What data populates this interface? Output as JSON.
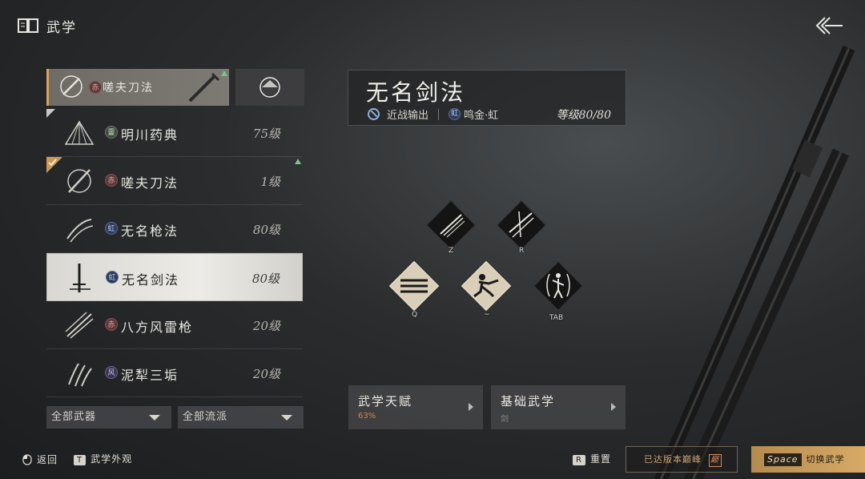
{
  "header": {
    "title": "武学",
    "book_icon": "book-icon",
    "back_icon": "back-arrow-icon"
  },
  "martial_list": {
    "equipped": {
      "badge": "赤",
      "name": "嗟夫刀法"
    },
    "items": [
      {
        "badge": "靈",
        "name": "明川药典",
        "level": "75级",
        "badge_color": "green"
      },
      {
        "badge": "赤",
        "name": "嗟夫刀法",
        "level": "1级",
        "badge_color": "red"
      },
      {
        "badge": "虹",
        "name": "无名枪法",
        "level": "80级",
        "badge_color": "blue"
      },
      {
        "badge": "虹",
        "name": "无名剑法",
        "level": "80级",
        "badge_color": "blue"
      },
      {
        "badge": "赤",
        "name": "八方风雷枪",
        "level": "20级",
        "badge_color": "red"
      },
      {
        "badge": "风",
        "name": "泥犁三垢",
        "level": "20级",
        "badge_color": "purple"
      }
    ]
  },
  "filters": {
    "weapon": "全部武器",
    "school": "全部流派"
  },
  "detail": {
    "title": "无名剑法",
    "role": "近战输出",
    "badge": "虹",
    "school": "鸣金·虹",
    "level": "等级80/80"
  },
  "skills": [
    {
      "key": "Z",
      "style": "dark"
    },
    {
      "key": "R",
      "style": "dark"
    },
    {
      "key": "Q",
      "style": "light"
    },
    {
      "key": "~",
      "style": "light"
    },
    {
      "key": "TAB",
      "style": "dark"
    }
  ],
  "panels": {
    "talent": {
      "title": "武学天赋",
      "sub": "63%"
    },
    "basic": {
      "title": "基础武学",
      "sub": "剑"
    }
  },
  "footer": {
    "back_label": "返回",
    "appearance_key": "T",
    "appearance_label": "武学外观",
    "reset_key": "R",
    "reset_label": "重置",
    "reached_text": "已达版本巅峰",
    "reached_icon": "巅",
    "switch_key": "Space",
    "switch_label": "切换武学"
  },
  "colors": {
    "accent": "#d7aa66",
    "selected_bg": "#ecebe6",
    "talent_progress": "#d2893f"
  }
}
